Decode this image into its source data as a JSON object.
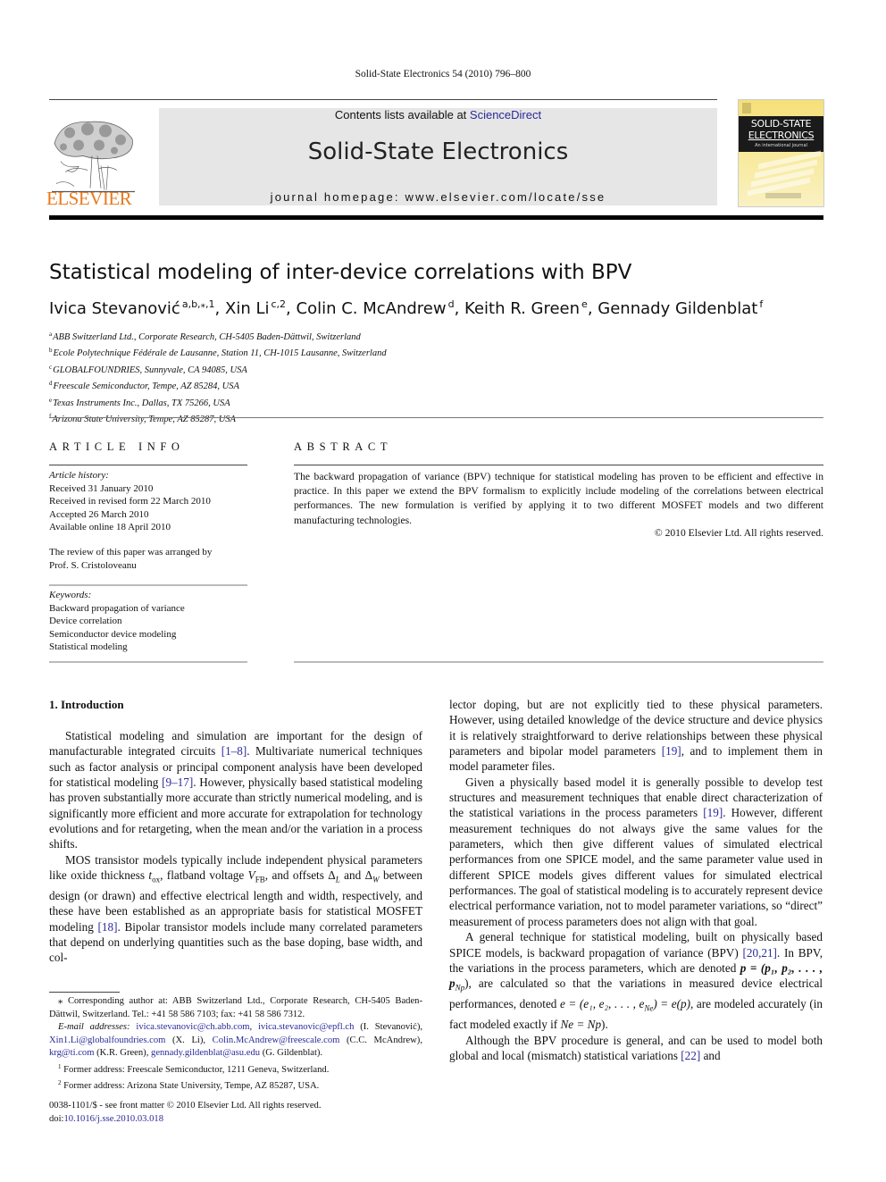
{
  "running_head": "Solid-State Electronics 54 (2010) 796–800",
  "publisher": {
    "logo_word": "ELSEVIER",
    "logo_color": "#e87a1e"
  },
  "banner": {
    "contents_prefix": "Contents lists available at ",
    "contents_link": "ScienceDirect",
    "journal_title": "Solid-State Electronics",
    "homepage_prefix": "journal homepage: ",
    "homepage_url": "www.elsevier.com/locate/sse"
  },
  "cover": {
    "line1": "SOLID-STATE",
    "line2": "ELECTRONICS",
    "line3": "An international journal"
  },
  "article": {
    "title": "Statistical modeling of inter-device correlations with BPV",
    "authors": [
      {
        "name": "Ivica Stevanović",
        "sup": "a,b,⁎,1"
      },
      {
        "name": "Xin Li",
        "sup": "c,2"
      },
      {
        "name": "Colin C. McAndrew",
        "sup": "d"
      },
      {
        "name": "Keith R. Green",
        "sup": "e"
      },
      {
        "name": "Gennady Gildenblat",
        "sup": "f"
      }
    ],
    "affiliations": [
      {
        "mark": "a",
        "text": "ABB Switzerland Ltd., Corporate Research, CH-5405 Baden-Dättwil, Switzerland"
      },
      {
        "mark": "b",
        "text": "Ecole Polytechnique Fédérale de Lausanne, Station 11, CH-1015 Lausanne, Switzerland"
      },
      {
        "mark": "c",
        "text": "GLOBALFOUNDRIES, Sunnyvale, CA 94085, USA"
      },
      {
        "mark": "d",
        "text": "Freescale Semiconductor, Tempe, AZ 85284, USA"
      },
      {
        "mark": "e",
        "text": "Texas Instruments Inc., Dallas, TX 75266, USA"
      },
      {
        "mark": "f",
        "text": "Arizona State University, Tempe, AZ 85287, USA"
      }
    ]
  },
  "article_info": {
    "heading": "ARTICLE INFO",
    "history_label": "Article history:",
    "history": [
      "Received 31 January 2010",
      "Received in revised form 22 March 2010",
      "Accepted 26 March 2010",
      "Available online 18 April 2010"
    ],
    "review_note_1": "The review of this paper was arranged by",
    "review_note_2": "Prof. S. Cristoloveanu",
    "keywords_label": "Keywords:",
    "keywords": [
      "Backward propagation of variance",
      "Device correlation",
      "Semiconductor device modeling",
      "Statistical modeling"
    ]
  },
  "abstract": {
    "heading": "ABSTRACT",
    "body": "The backward propagation of variance (BPV) technique for statistical modeling has proven to be efficient and effective in practice. In this paper we extend the BPV formalism to explicitly include modeling of the correlations between electrical performances. The new formulation is verified by applying it to two different MOSFET models and two different manufacturing technologies.",
    "copyright": "© 2010 Elsevier Ltd. All rights reserved."
  },
  "intro": {
    "heading": "1. Introduction",
    "p1": {
      "a": "Statistical modeling and simulation are important for the design of manufacturable integrated circuits ",
      "ref1": "[1–8]",
      "b": ". Multivariate numerical techniques such as factor analysis or principal component analysis have been developed for statistical modeling ",
      "ref2": "[9–17]",
      "c": ". However, physically based statistical modeling has proven substantially more accurate than strictly numerical modeling, and is significantly more efficient and more accurate for extrapolation for technology evolutions and for retargeting, when the mean and/or the variation in a process shifts."
    },
    "p2": {
      "a": "MOS transistor models typically include independent physical parameters like oxide thickness ",
      "tox": "t",
      "tox_sub": "ox",
      "b": ", flatband voltage ",
      "vfb": "V",
      "vfb_sub": "FB",
      "c": ", and offsets ",
      "dl": "Δ",
      "dl_sub": "L",
      "d": " and ",
      "dw": "Δ",
      "dw_sub": "W",
      "e": " between design (or drawn) and effective electrical length and width, respectively, and these have been established as an appropriate basis for statistical MOSFET modeling ",
      "ref": "[18]",
      "f": ". Bipolar transistor models include many correlated parameters that depend on underlying quantities such as the base doping, base width, and collector doping, but are not explicitly tied to these physical parameters. However, using detailed knowledge of the device structure and device physics it is relatively straightforward to derive relationships between these physical parameters and bipolar model parameters ",
      "ref2": "[19]",
      "g": ", and to implement them in model parameter files."
    },
    "p3": {
      "a": "Given a physically based model it is generally possible to develop test structures and measurement techniques that enable direct characterization of the statistical variations in the process parameters ",
      "ref": "[19]",
      "b": ". However, different measurement techniques do not always give the same values for the parameters, which then give different values of simulated electrical performances from one SPICE model, and the same parameter value used in different SPICE models gives different values for simulated electrical performances. The goal of statistical modeling is to accurately represent device electrical performance variation, not to model parameter variations, so “direct” measurement of process parameters does not align with that goal."
    },
    "p4": {
      "a": "A general technique for statistical modeling, built on physically based SPICE models, is backward propagation of variance (BPV) ",
      "ref": "[20,21]",
      "b": ". In BPV, the variations in the process parameters, which are denoted ",
      "p_eq": "p = (p₁, p₂, . . . , p",
      "p_eq_sub": "Np",
      "p_eq_end": ")",
      "c": ", are calculated so that the variations in measured device electrical performances, denoted ",
      "e_eq": "e = (e₁, e₂, . . . , e",
      "e_eq_sub": "Ne",
      "e_eq_end": ") = e(p)",
      "d": ", are modeled accurately (in fact modeled exactly if ",
      "n_eq": "Ne = Np",
      "e": ")."
    },
    "p5": {
      "a": "Although the BPV procedure is general, and can be used to model both global and local (mismatch) statistical variations ",
      "ref": "[22]",
      "b": " and"
    }
  },
  "footnotes": {
    "corresponding": "⁎ Corresponding author at: ABB Switzerland Ltd., Corporate Research, CH-5405 Baden-Dättwil, Switzerland. Tel.: +41 58 586 7103; fax: +41 58 586 7312.",
    "email_label": "E-mail addresses: ",
    "emails": [
      {
        "addr": "ivica.stevanovic@ch.abb.com",
        "after": ", "
      },
      {
        "addr": "ivica.stevanovic@epfl.ch",
        "after": " (I. Stevanović), "
      },
      {
        "addr": "Xin1.Li@globalfoundries.com",
        "after": " (X. Li), "
      },
      {
        "addr": "Colin.McAndrew@freescale.com",
        "after": " (C.C. McAndrew), "
      },
      {
        "addr": "krg@ti.com",
        "after": " (K.R. Green), "
      },
      {
        "addr": "gennady.gildenblat@asu.edu",
        "after": " (G. Gildenblat)."
      }
    ],
    "fn1": "Former address: Freescale Semiconductor, 1211 Geneva, Switzerland.",
    "fn2": "Former address: Arizona State University, Tempe, AZ 85287, USA."
  },
  "front_matter": {
    "issn_line": "0038-1101/$ - see front matter © 2010 Elsevier Ltd. All rights reserved.",
    "doi_prefix": "doi:",
    "doi": "10.1016/j.sse.2010.03.018"
  },
  "colors": {
    "link": "#2a2a9a",
    "banner_bg": "#e6e6e6",
    "elsevier_orange": "#e87a1e"
  }
}
